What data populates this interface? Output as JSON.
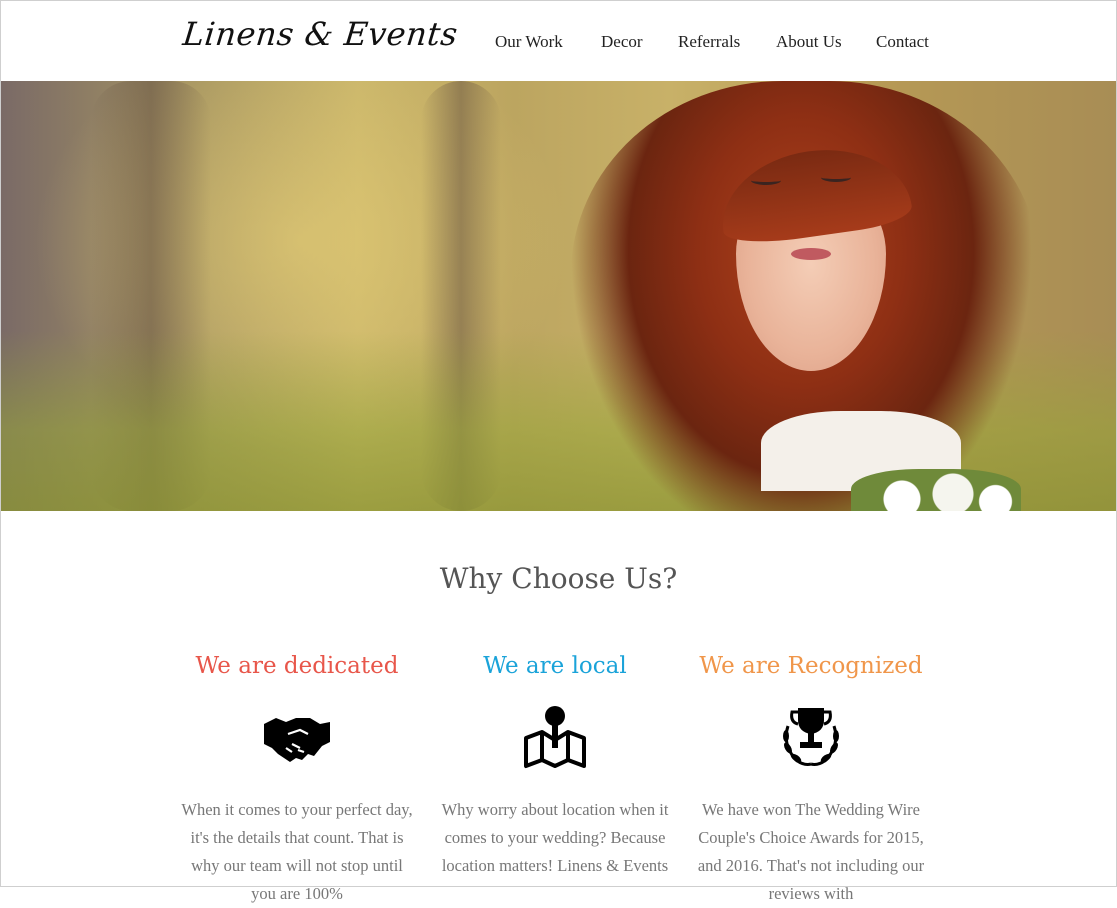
{
  "header": {
    "logo": "Linens & Events",
    "nav": [
      "Our Work",
      "Decor",
      "Referrals",
      "About Us",
      "Contact"
    ]
  },
  "section": {
    "title": "Why Choose Us?",
    "features": [
      {
        "heading": "We are dedicated",
        "color": "#e8564a",
        "icon": "handshake-icon",
        "text": "When it comes to your perfect day, it's the details that count. That is why our team will not stop until you are 100%"
      },
      {
        "heading": "We are local",
        "color": "#1aa3d9",
        "icon": "map-pin-icon",
        "text": "Why worry about location when it comes to your wedding? Because location matters! Linens & Events"
      },
      {
        "heading": "We are Recognized",
        "color": "#f0964a",
        "icon": "trophy-icon",
        "text": "We have won The Wedding Wire Couple's Choice Awards for 2015, and 2016. That's not including our reviews with"
      }
    ]
  }
}
